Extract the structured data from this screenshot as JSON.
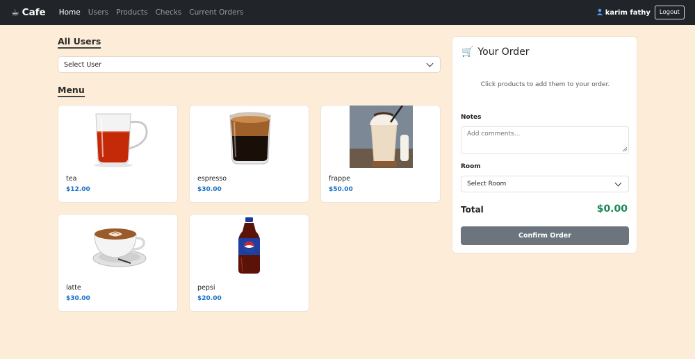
{
  "navbar": {
    "brand": "Cafe",
    "brand_icon": "coffee-cup-icon",
    "links": [
      {
        "label": "Home",
        "active": true
      },
      {
        "label": "Users",
        "active": false
      },
      {
        "label": "Products",
        "active": false
      },
      {
        "label": "Checks",
        "active": false
      },
      {
        "label": "Current Orders",
        "active": false
      }
    ],
    "user_name": "karim fathy",
    "user_icon": "person-icon",
    "logout_label": "Logout"
  },
  "users_section": {
    "title": "All Users",
    "select_value": "Select User"
  },
  "menu": {
    "title": "Menu",
    "products": [
      {
        "name": "tea",
        "price": "$12.00",
        "image": "tea-cup"
      },
      {
        "name": "espresso",
        "price": "$30.00",
        "image": "espresso-shot"
      },
      {
        "name": "frappe",
        "price": "$50.00",
        "image": "frappe-glass"
      },
      {
        "name": "latte",
        "price": "$30.00",
        "image": "latte-cup"
      },
      {
        "name": "pepsi",
        "price": "$20.00",
        "image": "pepsi-bottle"
      }
    ]
  },
  "order": {
    "title": "Your Order",
    "title_icon": "cart-icon",
    "hint": "Click products to add them to your order.",
    "notes_label": "Notes",
    "notes_placeholder": "Add comments...",
    "room_label": "Room",
    "room_value": "Select Room",
    "total_label": "Total",
    "total_value": "$0.00",
    "confirm_label": "Confirm Order"
  },
  "colors": {
    "navbar_bg": "#212529",
    "page_bg": "#fdecd7",
    "price": "#1a6fc9",
    "total": "#198754",
    "confirm_button": "#6c757d"
  }
}
